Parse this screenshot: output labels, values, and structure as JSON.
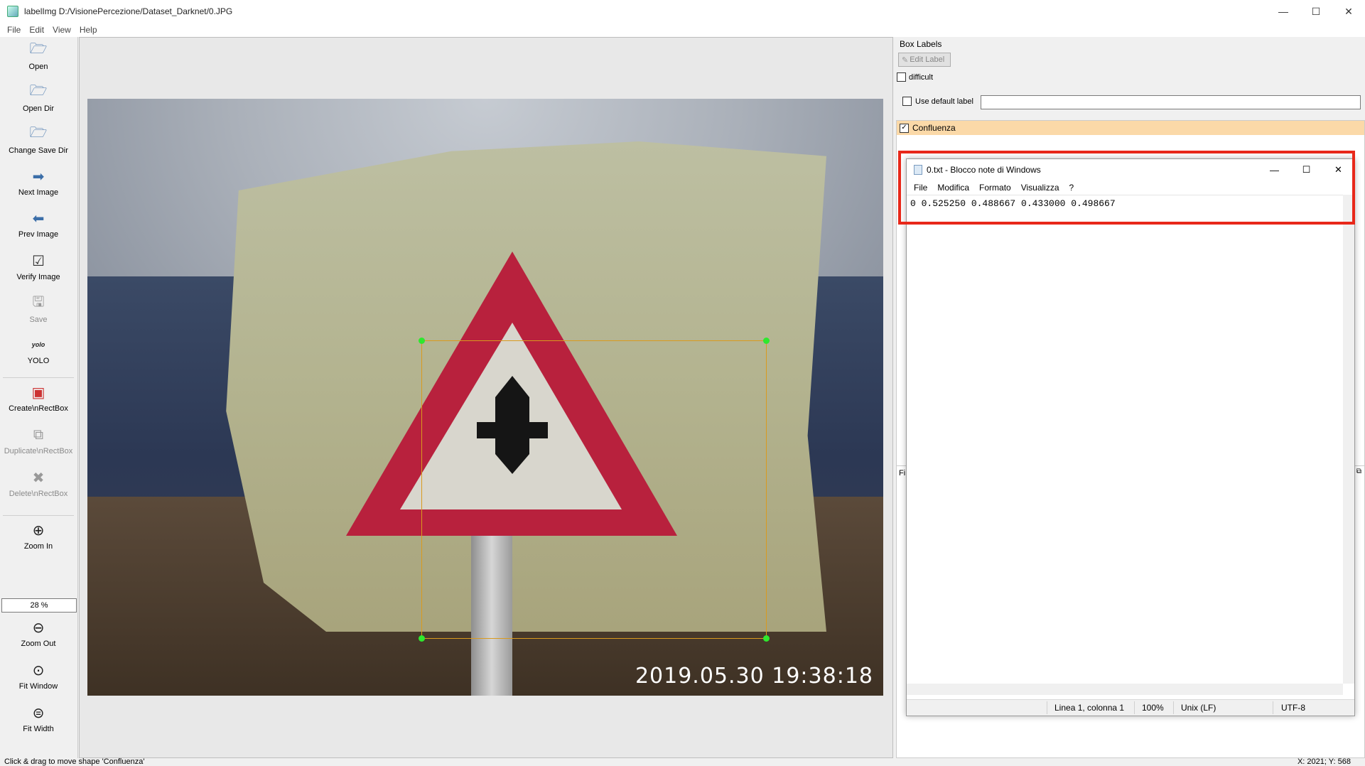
{
  "window": {
    "title": "labelImg D:/VisionePercezione/Dataset_Darknet/0.JPG",
    "controls": [
      "—",
      "☐",
      "✕"
    ]
  },
  "menu": [
    "File",
    "Edit",
    "View",
    "Help"
  ],
  "toolbar": {
    "open": "Open",
    "open_dir": "Open Dir",
    "change_save_dir": "Change Save Dir",
    "next_image": "Next Image",
    "prev_image": "Prev Image",
    "verify_image": "Verify Image",
    "save": "Save",
    "format_icon_text": "yolo",
    "format": "YOLO",
    "create_rect": "Create\\nRectBox",
    "duplicate_rect": "Duplicate\\nRectBox",
    "delete_rect": "Delete\\nRectBox",
    "zoom_in": "Zoom In",
    "zoom_value": "28 %",
    "zoom_out": "Zoom Out",
    "fit_window": "Fit Window",
    "fit_width": "Fit Width"
  },
  "photo": {
    "timestamp": "2019.05.30  19:38:18"
  },
  "right_panel": {
    "dock_title": "Box Labels",
    "edit_label": "Edit Label",
    "difficult": "difficult",
    "use_default_label": "Use default label",
    "default_label_value": "",
    "labels": [
      {
        "name": "Confluenza",
        "checked": true
      }
    ],
    "file_list_title": "Fi"
  },
  "notepad": {
    "title": "0.txt - Blocco note di Windows",
    "menu": [
      "File",
      "Modifica",
      "Formato",
      "Visualizza",
      "?"
    ],
    "content": "0 0.525250 0.488667 0.433000 0.498667",
    "status": {
      "position": "Linea 1, colonna 1",
      "zoom": "100%",
      "eol": "Unix (LF)",
      "encoding": "UTF-8"
    }
  },
  "statusbar": {
    "message": "Click & drag to move shape 'Confluenza'",
    "coords": "X: 2021; Y: 568"
  },
  "colors": {
    "highlight": "#e8281a",
    "bbox": "#d99a1e",
    "handle": "#2ee82e",
    "selected_label": "#fbd9a8"
  }
}
